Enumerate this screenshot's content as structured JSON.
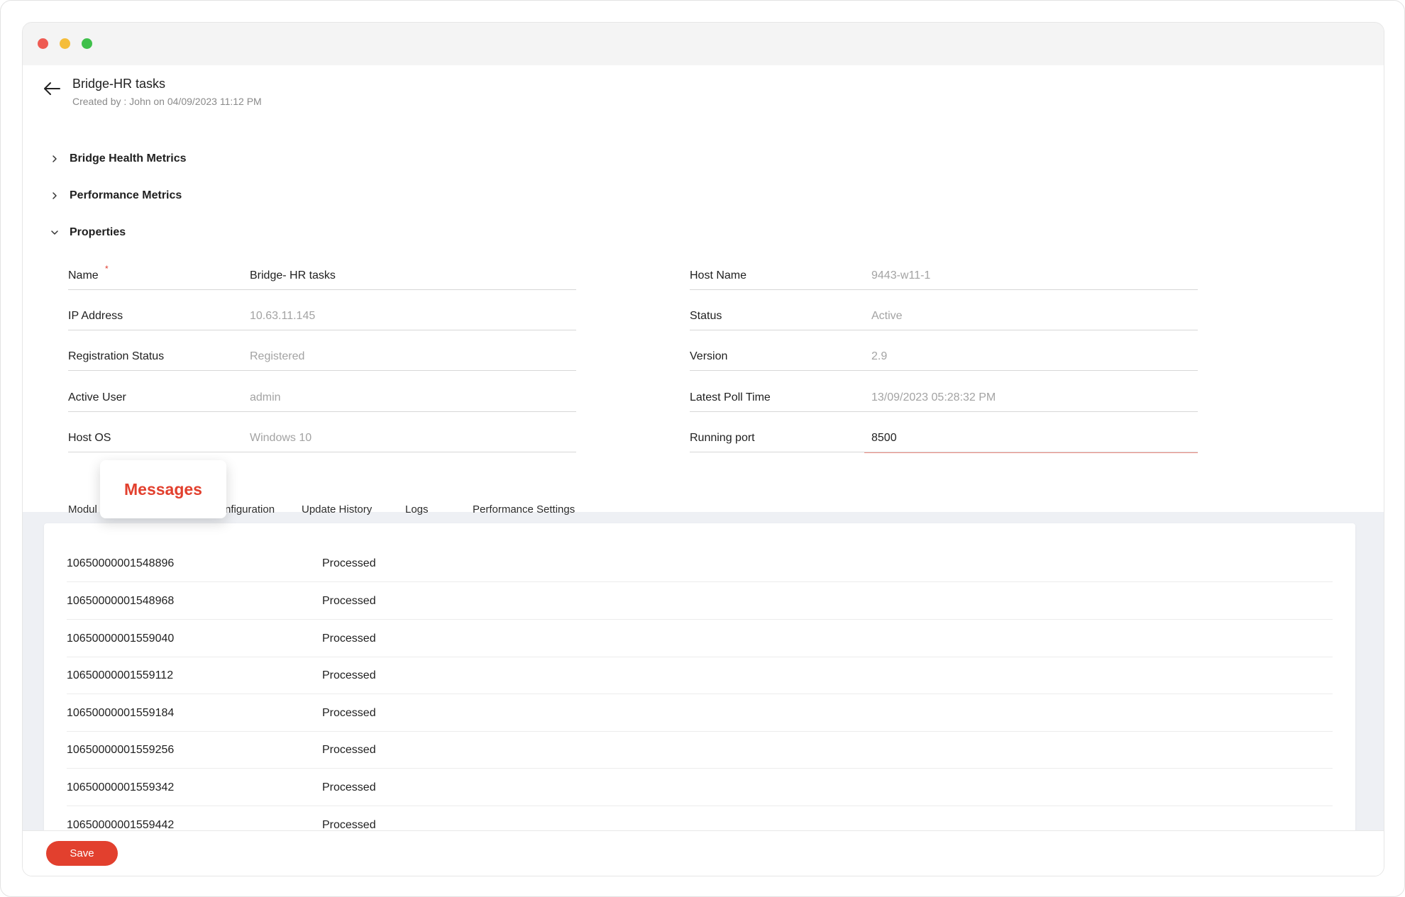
{
  "header": {
    "title": "Bridge-HR tasks",
    "subtitle": "Created by : John on 04/09/2023 11:12 PM"
  },
  "sections": {
    "health": "Bridge Health Metrics",
    "performance": "Performance Metrics",
    "properties": "Properties"
  },
  "properties": {
    "left": [
      {
        "label": "Name",
        "value": "Bridge- HR tasks",
        "required": "*"
      },
      {
        "label": "IP Address",
        "value": "10.63.11.145"
      },
      {
        "label": "Registration Status",
        "value": "Registered"
      },
      {
        "label": "Active User",
        "value": "admin"
      },
      {
        "label": "Host OS",
        "value": "Windows 10"
      }
    ],
    "right": [
      {
        "label": "Host Name",
        "value": "9443-w11-1"
      },
      {
        "label": "Status",
        "value": "Active"
      },
      {
        "label": "Version",
        "value": "2.9"
      },
      {
        "label": "Latest Poll Time",
        "value": "13/09/2023 05:28:32 PM"
      },
      {
        "label": "Running port",
        "value": "8500"
      }
    ]
  },
  "tabs": {
    "modules": "Modul",
    "messages": "Messages",
    "configuration": "nfiguration",
    "update_history": "Update History",
    "logs": "Logs",
    "performance_settings": "Performance Settings"
  },
  "messages": [
    {
      "id": "10650000001548896",
      "status": "Processed"
    },
    {
      "id": "10650000001548968",
      "status": "Processed"
    },
    {
      "id": "10650000001559040",
      "status": "Processed"
    },
    {
      "id": "10650000001559112",
      "status": "Processed"
    },
    {
      "id": "10650000001559184",
      "status": "Processed"
    },
    {
      "id": "10650000001559256",
      "status": "Processed"
    },
    {
      "id": "10650000001559342",
      "status": "Processed"
    },
    {
      "id": "10650000001559442",
      "status": "Processed"
    }
  ],
  "footer": {
    "save_label": "Save"
  },
  "colors": {
    "accent": "#e2402e",
    "muted_text": "#a3a3a3",
    "content_background": "#eef0f4"
  }
}
